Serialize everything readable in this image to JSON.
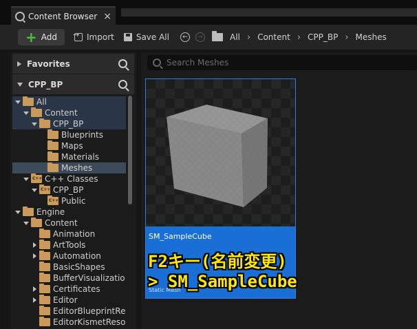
{
  "tab": {
    "title": "Content Browser",
    "close": "×"
  },
  "toolbar": {
    "add_label": "Add",
    "import_label": "Import",
    "save_all_label": "Save All",
    "breadcrumbs": [
      "All",
      "Content",
      "CPP_BP",
      "Meshes"
    ],
    "separator": "›"
  },
  "sidebar": {
    "favorites_label": "Favorites",
    "project_label": "CPP_BP",
    "tree": [
      {
        "label": "All",
        "depth": 0,
        "expanded": true,
        "icon": "folder-open-icon",
        "state": "highlighted"
      },
      {
        "label": "Content",
        "depth": 1,
        "expanded": true,
        "icon": "folder-open-icon",
        "state": "highlighted"
      },
      {
        "label": "CPP_BP",
        "depth": 2,
        "expanded": true,
        "icon": "folder-open-icon",
        "state": "highlighted"
      },
      {
        "label": "Blueprints",
        "depth": 3,
        "icon": "folder-icon"
      },
      {
        "label": "Maps",
        "depth": 3,
        "icon": "folder-icon"
      },
      {
        "label": "Materials",
        "depth": 3,
        "icon": "folder-icon"
      },
      {
        "label": "Meshes",
        "depth": 3,
        "icon": "folder-icon",
        "state": "selected"
      },
      {
        "label": "C++ Classes",
        "depth": 1,
        "expanded": true,
        "icon": "cpp-folder-icon"
      },
      {
        "label": "CPP_BP",
        "depth": 2,
        "expanded": true,
        "icon": "cpp-folder-icon"
      },
      {
        "label": "Public",
        "depth": 3,
        "icon": "cpp-folder-icon"
      },
      {
        "label": "Engine",
        "depth": 0,
        "expanded": true,
        "icon": "folder-open-icon"
      },
      {
        "label": "Content",
        "depth": 1,
        "expanded": true,
        "icon": "folder-open-icon"
      },
      {
        "label": "Animation",
        "depth": 2,
        "icon": "folder-icon"
      },
      {
        "label": "ArtTools",
        "depth": 2,
        "collapsed": true,
        "icon": "folder-icon"
      },
      {
        "label": "Automation",
        "depth": 2,
        "collapsed": true,
        "icon": "folder-icon"
      },
      {
        "label": "BasicShapes",
        "depth": 2,
        "icon": "folder-icon"
      },
      {
        "label": "BufferVisualizatio",
        "depth": 2,
        "icon": "folder-icon"
      },
      {
        "label": "Certificates",
        "depth": 2,
        "collapsed": true,
        "icon": "folder-icon"
      },
      {
        "label": "Editor",
        "depth": 2,
        "collapsed": true,
        "icon": "folder-icon"
      },
      {
        "label": "EditorBlueprintRe",
        "depth": 2,
        "icon": "folder-icon"
      },
      {
        "label": "EditorKismetReso",
        "depth": 2,
        "icon": "folder-icon"
      }
    ]
  },
  "search": {
    "placeholder": "Search Meshes"
  },
  "asset": {
    "name": "SM_SampleCube",
    "type": "Static Mesh"
  },
  "caption": {
    "line1": "F2キー(名前変更)",
    "line2": "> SM_SampleCube"
  },
  "colors": {
    "accent": "#1a6fd6",
    "folder": "#c99a5a",
    "caption": "#ffe800",
    "add_plus": "#4fbf3a"
  }
}
